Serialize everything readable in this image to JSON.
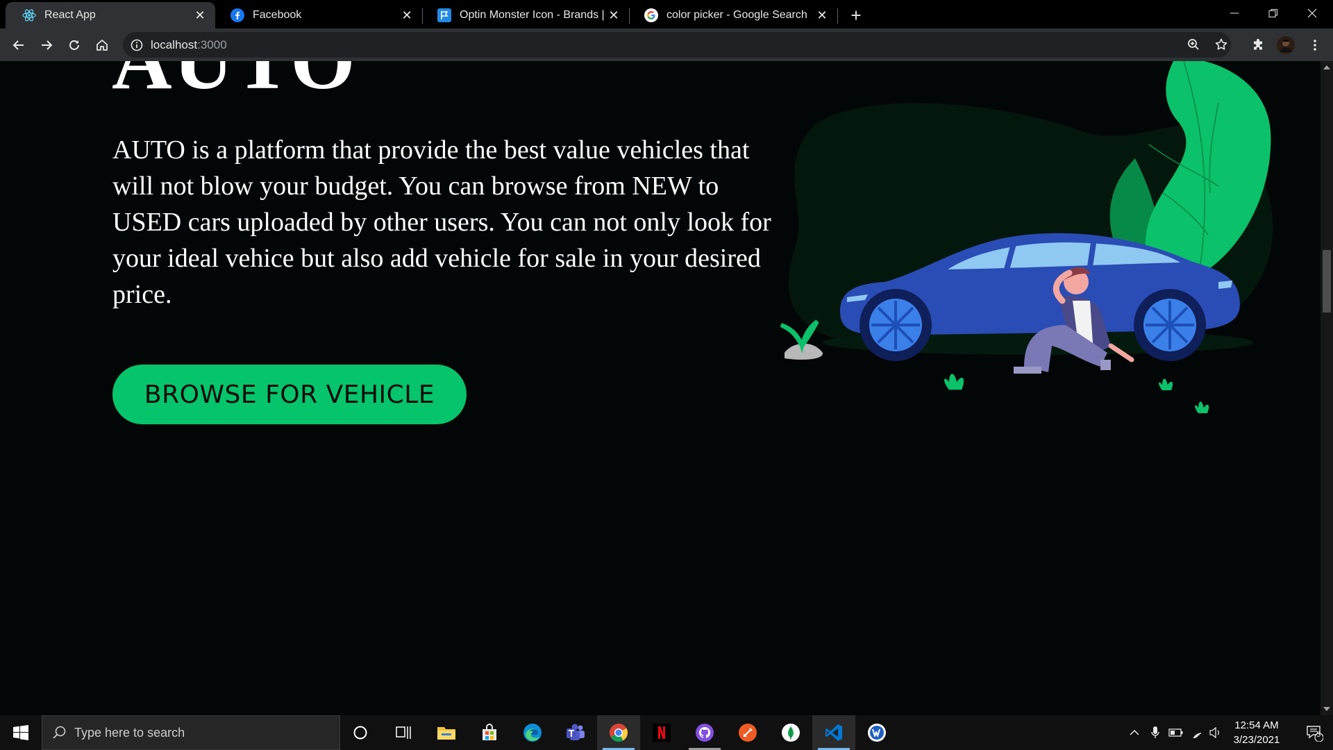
{
  "browser": {
    "tabs": [
      {
        "title": "React App",
        "icon": "react-icon",
        "active": true
      },
      {
        "title": "Facebook",
        "icon": "facebook-icon",
        "active": false
      },
      {
        "title": "Optin Monster Icon - Brands | Fo",
        "icon": "fontawesome-flag-icon",
        "active": false
      },
      {
        "title": "color picker - Google Search",
        "icon": "google-icon",
        "active": false
      }
    ],
    "url_host": "localhost",
    "url_port": ":3000"
  },
  "page": {
    "heading": "AUTO",
    "description": "AUTO is a platform that provide the best value vehicles that will not blow your budget. You can browse from NEW to USED cars uploaded by other users. You can not only look for your ideal vehice but also add vehicle for sale in your desired price.",
    "cta_label": "BROWSE FOR VEHICLE",
    "accent_color": "#05c46b",
    "background_color": "#030607"
  },
  "taskbar": {
    "search_placeholder": "Type here to search",
    "time": "12:54 AM",
    "date": "3/23/2021",
    "notification_count": "5",
    "pinned_apps": [
      "cortana-icon",
      "task-view-icon",
      "file-explorer-icon",
      "microsoft-store-icon",
      "edge-icon",
      "teams-icon",
      "chrome-icon",
      "netflix-icon",
      "github-icon",
      "postman-icon",
      "mongodb-compass-icon",
      "vscode-icon",
      "wordpress-icon"
    ]
  }
}
